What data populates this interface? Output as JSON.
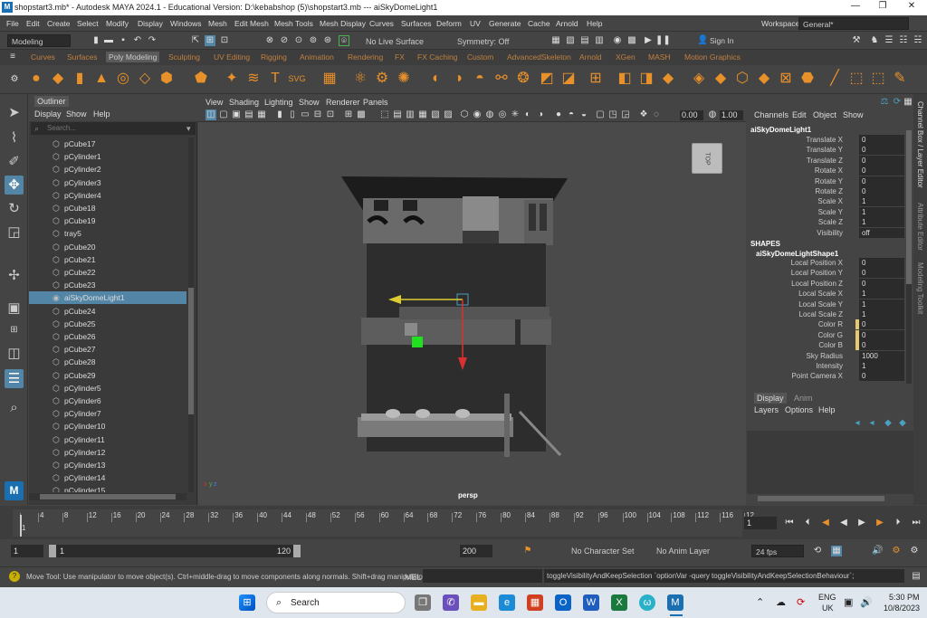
{
  "window": {
    "title": "shopstart3.mb* - Autodesk MAYA 2024.1 - Educational Version: D:\\kebabshop (5)\\shopstart3.mb   ---   aiSkyDomeLight1",
    "minimize": "—",
    "maximize": "❐",
    "close": "✕"
  },
  "menubar": {
    "items": [
      "File",
      "Edit",
      "Create",
      "Select",
      "Modify",
      "Display",
      "Windows",
      "Mesh",
      "Edit Mesh",
      "Mesh Tools",
      "Mesh Display",
      "Curves",
      "Surfaces",
      "Deform",
      "UV",
      "Generate",
      "Cache",
      "Arnold",
      "Help"
    ],
    "workspace_label": "Workspace:",
    "workspace_value": "General*"
  },
  "statusline": {
    "mode": "Modeling",
    "live_surface": "No Live Surface",
    "symmetry": "Symmetry: Off",
    "sign_in": "Sign In"
  },
  "shelf": {
    "tabs": [
      "Curves",
      "Surfaces",
      "Poly Modeling",
      "Sculpting",
      "UV Editing",
      "Rigging",
      "Animation",
      "Rendering",
      "FX",
      "FX Caching",
      "Custom",
      "AdvancedSkeleton",
      "Arnold",
      "XGen",
      "MASH",
      "Motion Graphics"
    ],
    "active_tab": "Poly Modeling"
  },
  "outliner": {
    "title": "Outliner",
    "menu": [
      "Display",
      "Show",
      "Help"
    ],
    "search_placeholder": "Search...",
    "items": [
      "pCube17",
      "pCylinder1",
      "pCylinder2",
      "pCylinder3",
      "pCylinder4",
      "pCube18",
      "pCube19",
      "tray5",
      "pCube20",
      "pCube21",
      "pCube22",
      "pCube23",
      "aiSkyDomeLight1",
      "pCube24",
      "pCube25",
      "pCube26",
      "pCube27",
      "pCube28",
      "pCube29",
      "pCylinder5",
      "pCylinder6",
      "pCylinder7",
      "pCylinder10",
      "pCylinder11",
      "pCylinder12",
      "pCylinder13",
      "pCylinder14",
      "pCylinder15"
    ],
    "selected": "aiSkyDomeLight1"
  },
  "viewport": {
    "menu": [
      "View",
      "Shading",
      "Lighting",
      "Show",
      "Renderer",
      "Panels"
    ],
    "exposure": "0.00",
    "gamma": "1.00",
    "camera_label": "persp",
    "viewcube_label": "TOP"
  },
  "channelbox": {
    "menu": [
      "Channels",
      "Edit",
      "Object",
      "Show"
    ],
    "node": "aiSkyDomeLight1",
    "attributes": [
      {
        "label": "Translate X",
        "value": "0"
      },
      {
        "label": "Translate Y",
        "value": "0"
      },
      {
        "label": "Translate Z",
        "value": "0"
      },
      {
        "label": "Rotate X",
        "value": "0"
      },
      {
        "label": "Rotate Y",
        "value": "0"
      },
      {
        "label": "Rotate Z",
        "value": "0"
      },
      {
        "label": "Scale X",
        "value": "1"
      },
      {
        "label": "Scale Y",
        "value": "1"
      },
      {
        "label": "Scale Z",
        "value": "1"
      },
      {
        "label": "Visibility",
        "value": "off"
      }
    ],
    "shapes_header": "SHAPES",
    "shape_node": "aiSkyDomeLightShape1",
    "shape_attributes": [
      {
        "label": "Local Position X",
        "value": "0"
      },
      {
        "label": "Local Position Y",
        "value": "0"
      },
      {
        "label": "Local Position Z",
        "value": "0"
      },
      {
        "label": "Local Scale X",
        "value": "1"
      },
      {
        "label": "Local Scale Y",
        "value": "1"
      },
      {
        "label": "Local Scale Z",
        "value": "1"
      },
      {
        "label": "Color R",
        "value": "0"
      },
      {
        "label": "Color G",
        "value": "0"
      },
      {
        "label": "Color B",
        "value": "0"
      },
      {
        "label": "Sky Radius",
        "value": "1000"
      },
      {
        "label": "Intensity",
        "value": "1"
      },
      {
        "label": "Point Camera X",
        "value": "0"
      }
    ]
  },
  "sidetabs": [
    "Channel Box / Layer Editor",
    "Attribute Editor",
    "Modeling Toolkit"
  ],
  "layereditor": {
    "tabs": [
      "Display",
      "Anim"
    ],
    "menu": [
      "Layers",
      "Options",
      "Help"
    ]
  },
  "timeslider": {
    "ticks": [
      "1",
      "4",
      "8",
      "12",
      "16",
      "20",
      "24",
      "28",
      "32",
      "36",
      "40",
      "44",
      "48",
      "52",
      "56",
      "60",
      "64",
      "68",
      "72",
      "76",
      "80",
      "84",
      "88",
      "92",
      "96",
      "100",
      "104",
      "108",
      "112",
      "116",
      "12"
    ],
    "current_frame": "1"
  },
  "rangebar": {
    "start": "1",
    "inner_start": "1",
    "inner_end": "120",
    "end": "200",
    "character_set": "No Character Set",
    "anim_layer": "No Anim Layer",
    "fps": "24 fps"
  },
  "helpline": {
    "text": "Move Tool: Use manipulator to move object(s). Ctrl+middle-drag to move components along normals. Shift+drag manipulator axis",
    "mel_label": "MEL",
    "result": "toggleVisibilityAndKeepSelection `optionVar -query toggleVisibilityAndKeepSelectionBehaviour`;"
  },
  "taskbar": {
    "search": "Search",
    "lang": "ENG",
    "region": "UK",
    "time": "5:30 PM",
    "date": "10/8/2023"
  },
  "colors": {
    "accent": "#5285a6",
    "shelf_orange": "#e8902a",
    "highlight": "#e8c870"
  }
}
